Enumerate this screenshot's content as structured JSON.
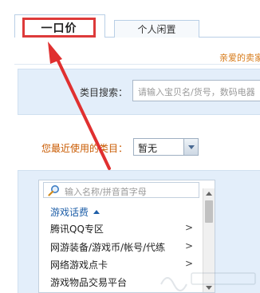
{
  "tabs": [
    {
      "label": "一口价",
      "active": true
    },
    {
      "label": "个人闲置",
      "active": false
    }
  ],
  "notice": "亲爱的卖家",
  "category_search": {
    "label": "类目搜索：",
    "placeholder": "请输入宝贝名/货号，数码电器"
  },
  "recent": {
    "label": "您最近使用的类目：",
    "selected": "暂无"
  },
  "category_list": {
    "search_placeholder": "输入名称/拼音首字母",
    "group_label": "游戏话费",
    "items": [
      {
        "label": "腾讯QQ专区",
        "has_submenu": true
      },
      {
        "label": "网游装备/游戏币/帐号/代练",
        "has_submenu": true
      },
      {
        "label": "网络游戏点卡",
        "has_submenu": true
      },
      {
        "label": "游戏物品交易平台",
        "has_submenu": false
      }
    ]
  },
  "colors": {
    "highlight_box": "#dd3a3a",
    "arrow": "#e03030",
    "link_blue": "#1f5fa8",
    "orange_label": "#c95a00",
    "panel_bg": "#e3eefa"
  },
  "icons": [
    "search-icon",
    "dropdown-arrow-icon",
    "chevron-right-icon",
    "collapse-arrow-icon"
  ]
}
